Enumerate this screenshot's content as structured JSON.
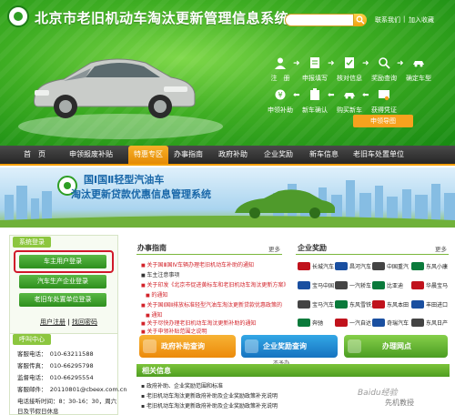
{
  "header": {
    "title": "北京市老旧机动车淘汰更新管理信息系统",
    "links": [
      "联系我们",
      "加入收藏"
    ],
    "separator": "|",
    "guide_button": "申领导图",
    "steps_row1": [
      "注　册",
      "申报填写",
      "核对信息",
      "奖励查询",
      "确定车型"
    ],
    "steps_row2": [
      "申领补助",
      "新车确认",
      "购买新车",
      "获得凭证"
    ]
  },
  "nav": {
    "items": [
      "首　页",
      "申领报废补贴",
      "特惠专区",
      "办事指南",
      "政府补助",
      "企业奖励",
      "新车信息",
      "老旧车处置单位"
    ],
    "active_index": 2
  },
  "banner": {
    "title1": "国Ⅰ国Ⅱ轻型汽油车",
    "title2": "淘汰更新贷款优惠信息管理系统"
  },
  "left": {
    "login_tab": "系统登录",
    "buttons": [
      "车主用户登录",
      "汽车生产企业登录",
      "老旧车处置单位登录"
    ],
    "links": [
      "用户注册",
      "找回密码"
    ],
    "link_separator": "|",
    "contact_tab": "呼叫中心",
    "contacts": [
      "客服电话：　010-63211588",
      "客服传真：　010-66295798",
      "监督电话：　010-66295554",
      "客服邮件：　20110801@cbeex.com.cn",
      "电话接听时间：8：30-16：30，周六",
      "日及节假日休息"
    ]
  },
  "middle": {
    "guide_title": "办事指南",
    "more": "更多",
    "news": [
      "关于国Ⅲ国Ⅳ车辆办理老旧机动车补助的通知",
      "车主注意事项",
      "关于印发《北京市促进黄标车和老旧机动车淘汰更新方案》",
      "的通知",
      "关于国Ⅰ国Ⅱ排放标准轻型汽油车淘汰更新贷款优惠政策的",
      "通知",
      "关于尽快办理老旧机动车淘汰更新补助的通知",
      "关于申领补贴范围之说明"
    ],
    "buttons": [
      "政府补助查询",
      "企业奖励查询",
      "办理网点"
    ],
    "subtitle": "不予办",
    "related_title": "相关信息",
    "related": [
      "政府补助、企业奖励范围和标准",
      "老旧机动车淘汰更新政府补助及企业奖励政策补充说明",
      "老旧机动车淘汰更新政府补助及企业奖励政策补充说明"
    ]
  },
  "right": {
    "title": "企业奖励",
    "more": "更多",
    "brands": [
      [
        "长城汽车",
        "昌河汽车",
        "中国重汽",
        "东风小康"
      ],
      [
        "宝马中国",
        "一汽轿车",
        "比亚迪",
        "华晨宝马"
      ],
      [
        "宝马汽车",
        "东风雪铁龙",
        "东风本田",
        "丰田进口"
      ],
      [
        "奔驰",
        "一汽自达",
        "奇瑞汽车",
        "东风日产"
      ]
    ],
    "brand_colors": [
      "#c0121c",
      "#1a4fa0",
      "#444444",
      "#0a7a3b"
    ]
  },
  "watermark": {
    "text": "Baidu经验",
    "tag": "先机教授"
  },
  "colors": {
    "header_green": "#3fae23",
    "nav_dark": "#262626",
    "accent_orange": "#f5a000",
    "login_green": "#2e8f1e",
    "highlight_red": "#d0182a",
    "news_red": "#d2232a"
  }
}
